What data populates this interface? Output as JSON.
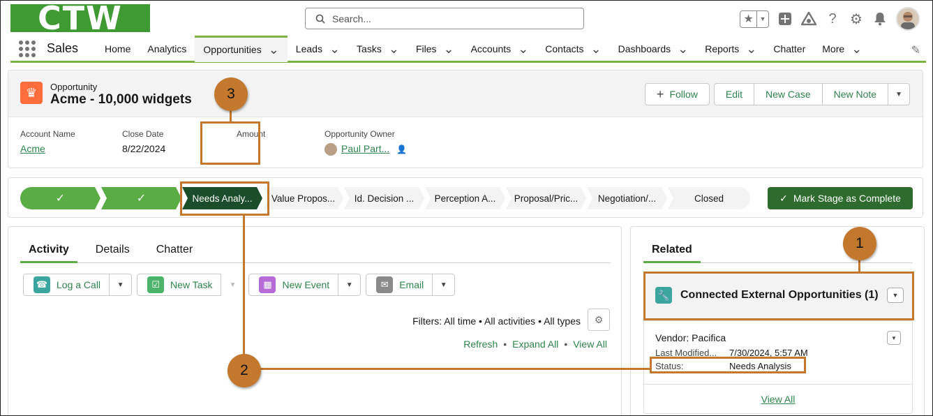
{
  "logo": "CTW",
  "search": {
    "placeholder": "Search..."
  },
  "nav": {
    "app_name": "Sales",
    "items": [
      {
        "label": "Home",
        "has_menu": false
      },
      {
        "label": "Analytics",
        "has_menu": false
      },
      {
        "label": "Opportunities",
        "has_menu": true,
        "active": true
      },
      {
        "label": "Leads",
        "has_menu": true
      },
      {
        "label": "Tasks",
        "has_menu": true
      },
      {
        "label": "Files",
        "has_menu": true
      },
      {
        "label": "Accounts",
        "has_menu": true
      },
      {
        "label": "Contacts",
        "has_menu": true
      },
      {
        "label": "Dashboards",
        "has_menu": true
      },
      {
        "label": "Reports",
        "has_menu": true
      },
      {
        "label": "Chatter",
        "has_menu": false
      },
      {
        "label": "More",
        "has_menu": true
      }
    ]
  },
  "record": {
    "object_type": "Opportunity",
    "name": "Acme - 10,000 widgets",
    "actions": {
      "follow": "Follow",
      "edit": "Edit",
      "new_case": "New Case",
      "new_note": "New Note"
    },
    "fields": {
      "account_label": "Account Name",
      "account_value": "Acme",
      "close_label": "Close Date",
      "close_value": "8/22/2024",
      "amount_label": "Amount",
      "amount_value": "",
      "owner_label": "Opportunity Owner",
      "owner_value": "Paul Part..."
    }
  },
  "path": {
    "stages": [
      {
        "label": "✓",
        "state": "done"
      },
      {
        "label": "✓",
        "state": "done"
      },
      {
        "label": "Needs Analy...",
        "state": "current"
      },
      {
        "label": "Value Propos...",
        "state": "todo"
      },
      {
        "label": "Id. Decision ...",
        "state": "todo"
      },
      {
        "label": "Perception A...",
        "state": "todo"
      },
      {
        "label": "Proposal/Pric...",
        "state": "todo"
      },
      {
        "label": "Negotiation/...",
        "state": "todo"
      },
      {
        "label": "Closed",
        "state": "todo"
      }
    ],
    "complete_label": "Mark Stage as Complete"
  },
  "activity": {
    "tabs": [
      "Activity",
      "Details",
      "Chatter"
    ],
    "publisher": {
      "log_call": "Log a Call",
      "new_task": "New Task",
      "new_event": "New Event",
      "email": "Email"
    },
    "filters": "Filters: All time • All activities • All types",
    "links": {
      "refresh": "Refresh",
      "expand": "Expand All",
      "view": "View All"
    }
  },
  "related": {
    "tab": "Related",
    "card_title": "Connected External Opportunities (1)",
    "item": {
      "name": "Vendor: Pacifica",
      "modified_label": "Last Modified...",
      "modified_value": "7/30/2024, 5:57 AM",
      "status_label": "Status:",
      "status_value": "Needs Analysis"
    },
    "view_all": "View All"
  },
  "annotations": {
    "badge_1": "1",
    "badge_2": "2",
    "badge_3": "3"
  },
  "colors": {
    "brand_green": "#3f9a34",
    "accent_green": "#5aac44",
    "current_stage": "#1c4d2a",
    "annotation": "#c4782e"
  }
}
